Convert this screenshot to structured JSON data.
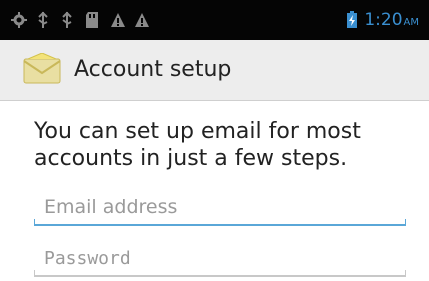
{
  "status_bar": {
    "icons": [
      "settings-icon",
      "usb-icon",
      "usb-icon",
      "sd-card-icon",
      "warning-icon",
      "warning-icon",
      "battery-charging-icon"
    ],
    "time": "1:20",
    "time_suffix": "AM",
    "time_color": "#3a8fd0"
  },
  "title_bar": {
    "icon": "email-envelope-icon",
    "title": "Account setup"
  },
  "main": {
    "intro": "You can set up email for most accounts in just a few steps.",
    "email_placeholder": "Email address",
    "email_value": "",
    "password_placeholder": "Password",
    "password_value": ""
  },
  "colors": {
    "accent": "#5aa7d8",
    "title_bar_bg": "#ededed",
    "status_bar_bg": "#050505"
  }
}
